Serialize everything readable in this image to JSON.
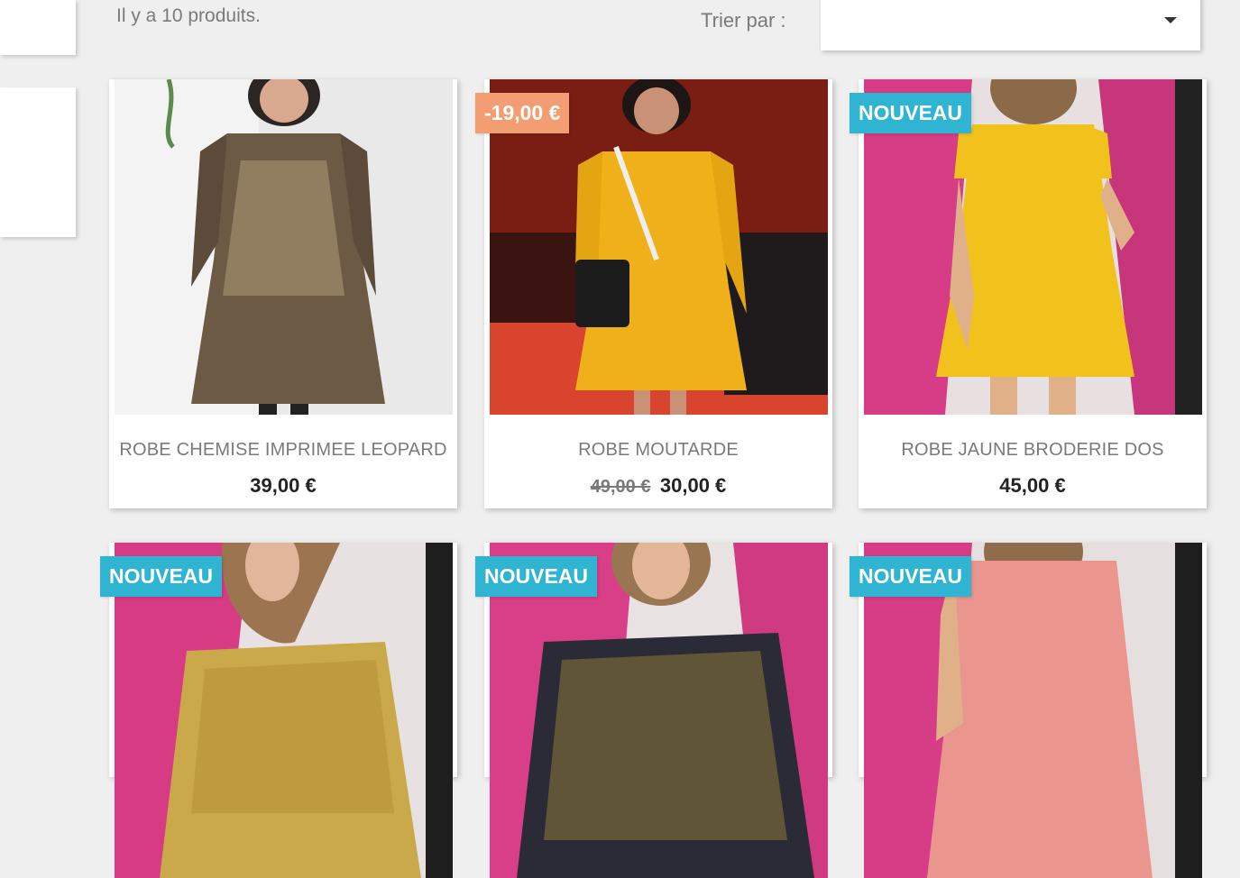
{
  "listing": {
    "product_count_text": "Il y a 10 produits.",
    "sort_label": "Trier par :",
    "sort_value": ""
  },
  "products": [
    {
      "title": "ROBE CHEMISE IMPRIMEE LEOPARD",
      "price": "39,00 €",
      "old_price": "",
      "flag": ""
    },
    {
      "title": "ROBE MOUTARDE",
      "price": "30,00 €",
      "old_price": "49,00 €",
      "flag": "-19,00 €"
    },
    {
      "title": "ROBE JAUNE BRODERIE DOS",
      "price": "45,00 €",
      "old_price": "",
      "flag": "NOUVEAU"
    },
    {
      "title": "",
      "price": "",
      "old_price": "",
      "flag": "NOUVEAU"
    },
    {
      "title": "",
      "price": "",
      "old_price": "",
      "flag": "NOUVEAU"
    },
    {
      "title": "",
      "price": "",
      "old_price": "",
      "flag": "NOUVEAU"
    }
  ],
  "colors": {
    "new_flag": "#2fb5d2",
    "discount_flag": "#f39d72",
    "background": "#efefef"
  }
}
